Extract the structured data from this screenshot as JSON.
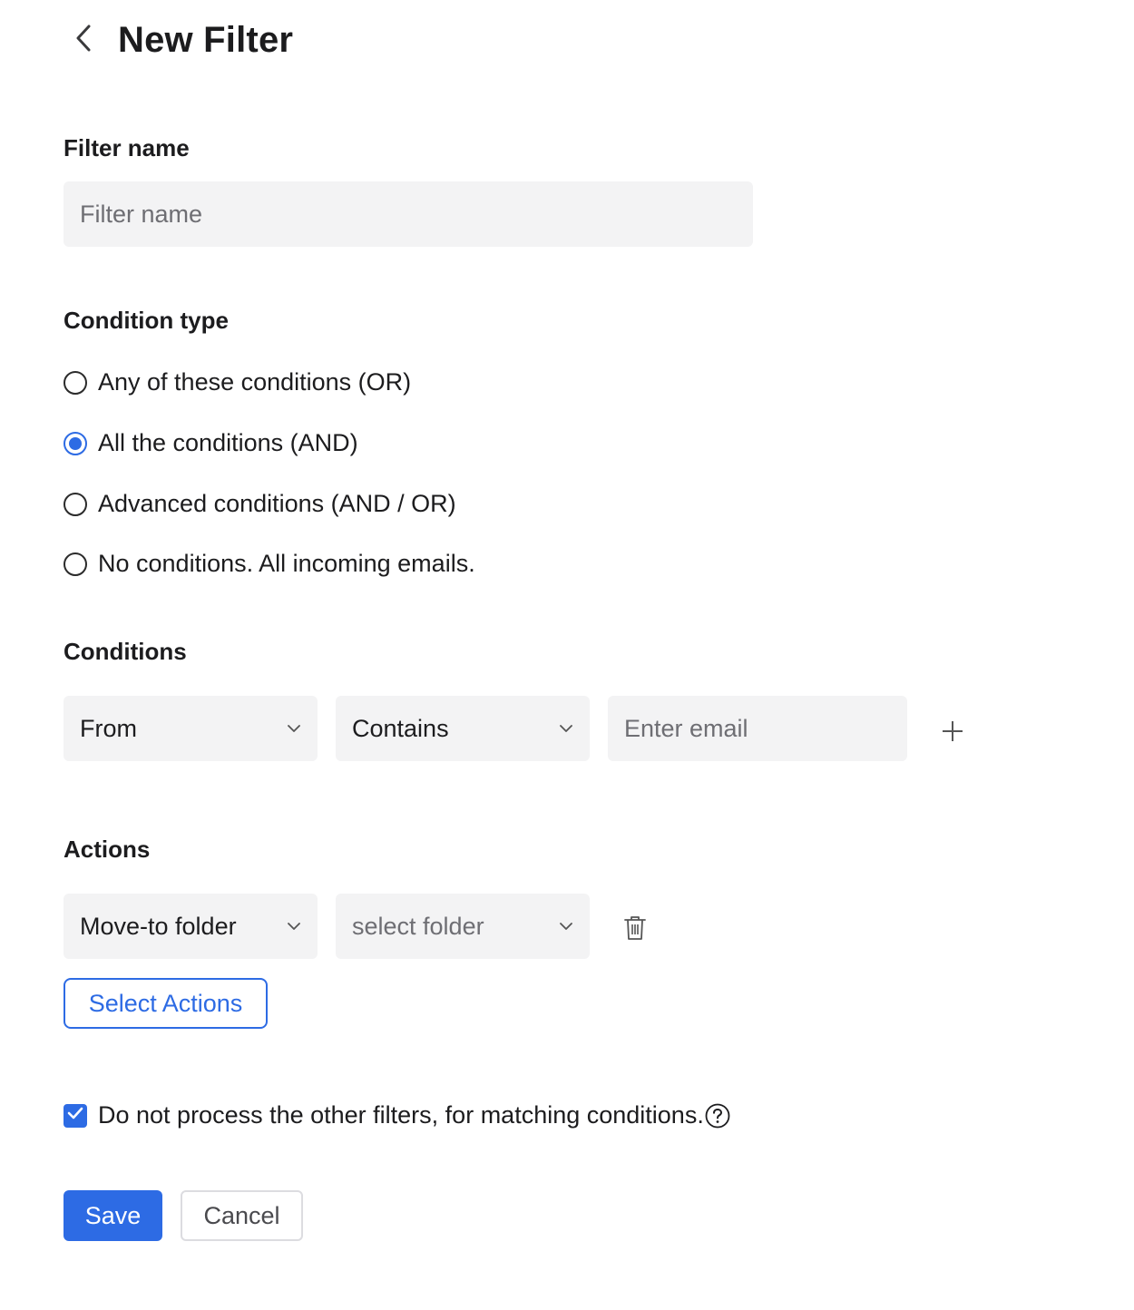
{
  "header": {
    "title": "New Filter"
  },
  "filter_name": {
    "label": "Filter name",
    "placeholder": "Filter name",
    "value": ""
  },
  "condition_type": {
    "label": "Condition type",
    "options": [
      {
        "label": "Any of these conditions (OR)",
        "checked": false
      },
      {
        "label": "All the conditions (AND)",
        "checked": true
      },
      {
        "label": "Advanced conditions (AND / OR)",
        "checked": false
      },
      {
        "label": "No conditions. All incoming emails.",
        "checked": false
      }
    ]
  },
  "conditions": {
    "label": "Conditions",
    "field": "From",
    "operator": "Contains",
    "value_placeholder": "Enter email"
  },
  "actions": {
    "label": "Actions",
    "action": "Move-to folder",
    "target_placeholder": "select folder",
    "select_actions_label": "Select Actions"
  },
  "stop_processing": {
    "label": "Do not process the other filters, for matching conditions.",
    "checked": true
  },
  "buttons": {
    "save": "Save",
    "cancel": "Cancel"
  },
  "colors": {
    "accent": "#2d6be4",
    "field_bg": "#f3f3f4",
    "text": "#1c1c1e"
  }
}
